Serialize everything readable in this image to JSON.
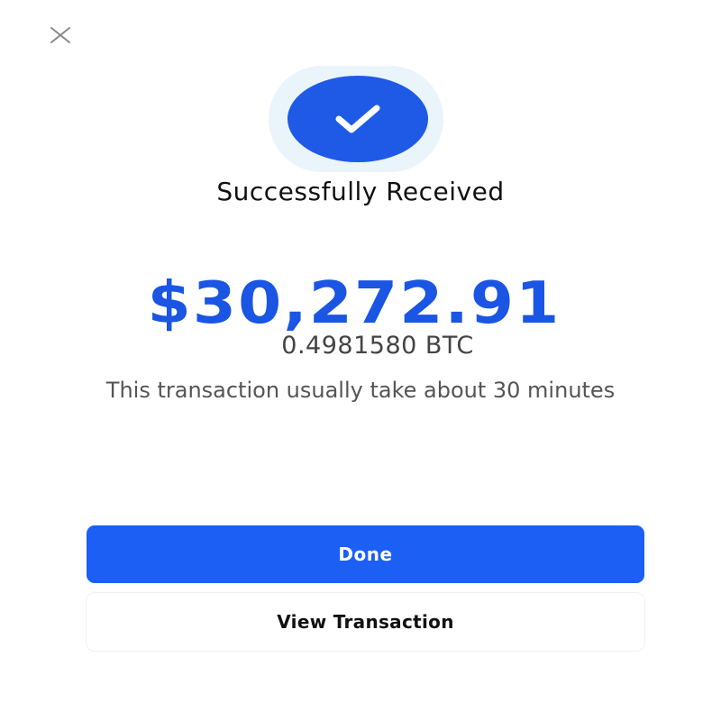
{
  "header": {
    "close_icon": "close-icon"
  },
  "status": {
    "icon": "checkmark-icon",
    "title": "Successfully Received"
  },
  "amount": {
    "fiat": "$30,272.91",
    "crypto": "0.4981580 BTC"
  },
  "note": "This transaction usually take about 30 minutes",
  "actions": {
    "done_label": "Done",
    "view_label": "View Transaction"
  },
  "colors": {
    "accent": "#1b5ff5",
    "amount": "#1a55e3",
    "halo": "#eaf4fb"
  }
}
